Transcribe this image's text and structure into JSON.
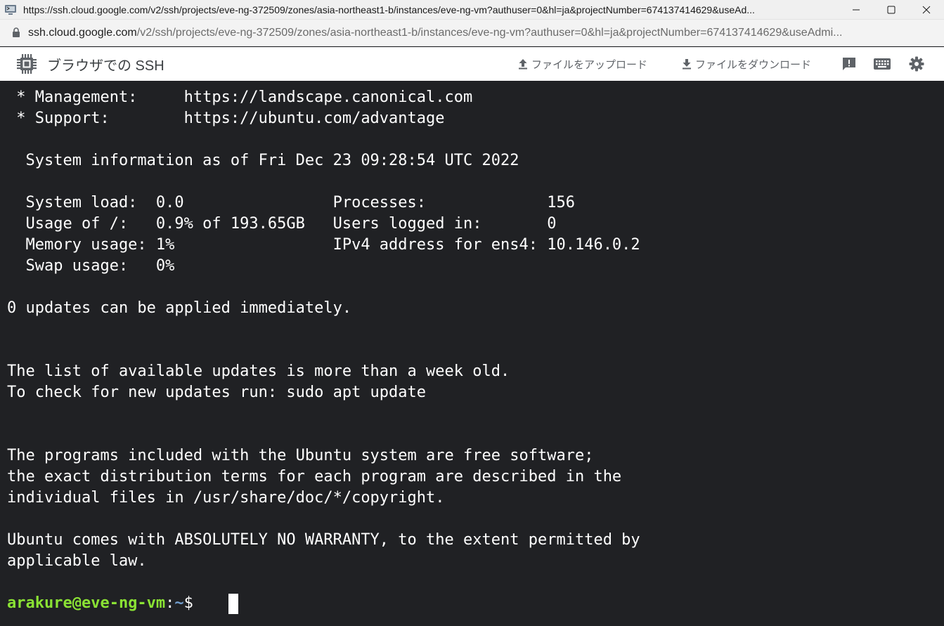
{
  "window": {
    "title": "https://ssh.cloud.google.com/v2/ssh/projects/eve-ng-372509/zones/asia-northeast1-b/instances/eve-ng-vm?authuser=0&hl=ja&projectNumber=674137414629&useAd..."
  },
  "address": {
    "host": "ssh.cloud.google.com",
    "path": "/v2/ssh/projects/eve-ng-372509/zones/asia-northeast1-b/instances/eve-ng-vm?authuser=0&hl=ja&projectNumber=674137414629&useAdmi..."
  },
  "toolbar": {
    "app_title": "ブラウザでの SSH",
    "upload_label": "ファイルをアップロード",
    "download_label": "ファイルをダウンロード",
    "icons": [
      "chip-icon",
      "upload-icon",
      "download-icon",
      "feedback-icon",
      "keyboard-icon",
      "settings-icon"
    ]
  },
  "terminal": {
    "lines": [
      " * Management:     https://landscape.canonical.com",
      " * Support:        https://ubuntu.com/advantage",
      "",
      "  System information as of Fri Dec 23 09:28:54 UTC 2022",
      "",
      "  System load:  0.0                Processes:             156",
      "  Usage of /:   0.9% of 193.65GB   Users logged in:       0",
      "  Memory usage: 1%                 IPv4 address for ens4: 10.146.0.2",
      "  Swap usage:   0%",
      "",
      "0 updates can be applied immediately.",
      "",
      "",
      "The list of available updates is more than a week old.",
      "To check for new updates run: sudo apt update",
      "",
      "",
      "The programs included with the Ubuntu system are free software;",
      "the exact distribution terms for each program are described in the",
      "individual files in /usr/share/doc/*/copyright.",
      "",
      "Ubuntu comes with ABSOLUTELY NO WARRANTY, to the extent permitted by",
      "applicable law.",
      ""
    ],
    "prompt": {
      "user_host": "arakure@eve-ng-vm",
      "separator": ":",
      "path": "~",
      "symbol": "$ "
    }
  },
  "colors": {
    "terminal_bg": "#202124",
    "terminal_fg": "#ffffff",
    "prompt_user": "#8ae234",
    "prompt_path": "#729fcf",
    "toolbar_icon": "#5f6368"
  }
}
